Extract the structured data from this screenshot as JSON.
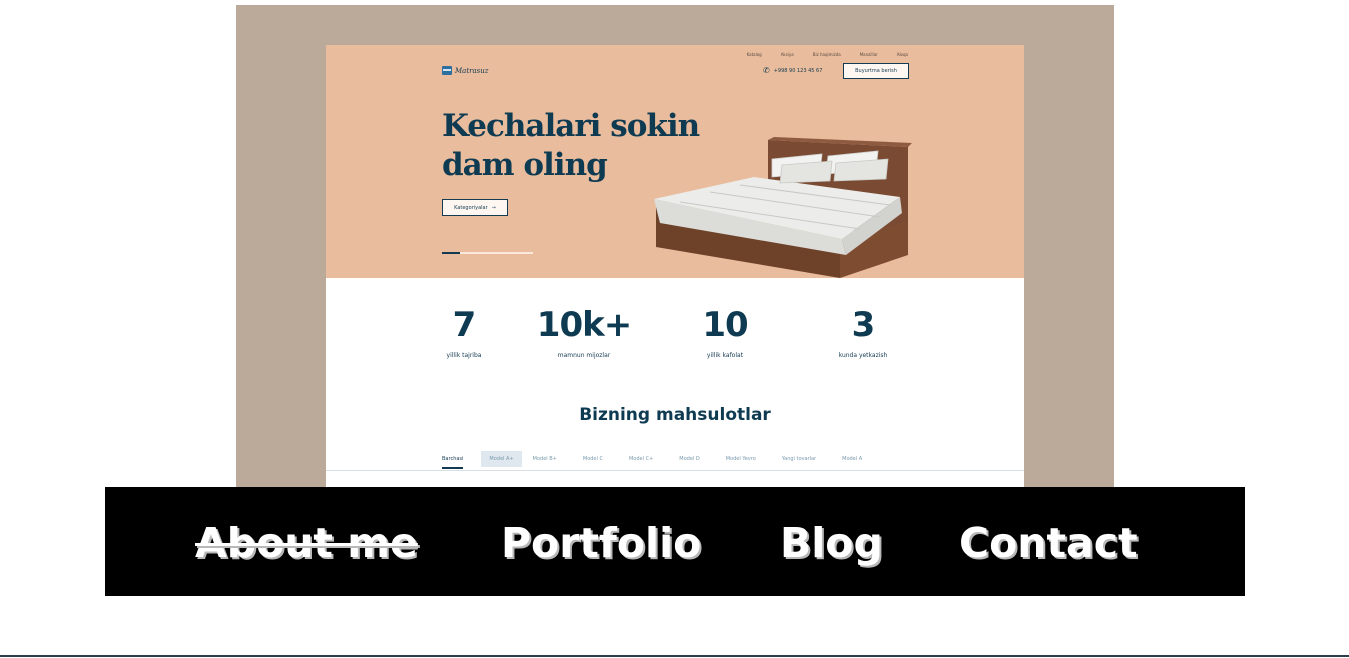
{
  "website": {
    "top_links": [
      "Katalog",
      "Aksiya",
      "Biz haqimizda",
      "Manzillar",
      "Aloqa"
    ],
    "logo_text": "Matrasuz",
    "phone": "+998 90 123 45 67",
    "order_button": "Buyurtma berish",
    "hero_title_line1": "Kechalari sokin",
    "hero_title_line2": "dam oling",
    "categories_button": "Kategoriyalar",
    "slider_progress": 0.2,
    "stats": [
      {
        "value": "7",
        "label": "yillik tajriba"
      },
      {
        "value": "10k+",
        "label": "mamnun mijozlar"
      },
      {
        "value": "10",
        "label": "yillik kafolat"
      },
      {
        "value": "3",
        "label": "kunda yetkazish"
      }
    ],
    "products_title": "Bizning mahsulotlar",
    "tabs": [
      "Barchasi",
      "Model A+",
      "Model B+",
      "Model C",
      "Model C+",
      "Model D",
      "Model Yevro",
      "Yangi tovarlar",
      "Model A"
    ],
    "colors": {
      "hero_bg": "#e8bc9c",
      "primary": "#0f3b52",
      "backdrop": "#bba999"
    }
  },
  "nav": {
    "about": "About me",
    "portfolio": "Portfolio",
    "blog": "Blog",
    "contact": "Contact"
  }
}
